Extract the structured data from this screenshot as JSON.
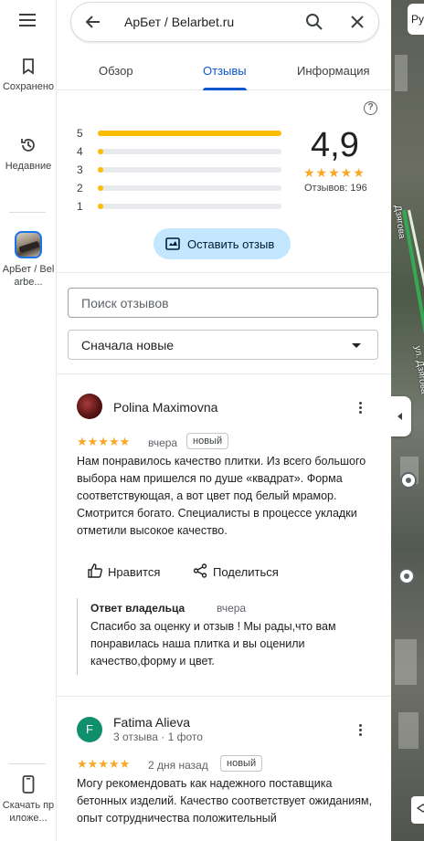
{
  "rail": {
    "saved_label": "Сохранено",
    "recent_label": "Недавние",
    "place_label": "АрБет / Belarbe...",
    "download_label": "Скачать приложе..."
  },
  "search": {
    "title": "АрБет / Belarbet.ru"
  },
  "tabs": [
    {
      "label": "Обзор",
      "active": false
    },
    {
      "label": "Отзывы",
      "active": true
    },
    {
      "label": "Информация",
      "active": false
    }
  ],
  "rating": {
    "average": "4,9",
    "total_label": "Отзывов: 196",
    "stars_filled": 5,
    "histogram": [
      {
        "stars": "5",
        "fraction": 1.0
      },
      {
        "stars": "4",
        "fraction": 0.02
      },
      {
        "stars": "3",
        "fraction": 0.01
      },
      {
        "stars": "2",
        "fraction": 0.01
      },
      {
        "stars": "1",
        "fraction": 0.02
      }
    ]
  },
  "write_review_label": "Оставить отзыв",
  "review_search_placeholder": "Поиск отзывов",
  "sort_selected": "Сначала новые",
  "reviews": [
    {
      "author": "Polina Maximovna",
      "meta": "",
      "stars": 5,
      "when": "вчера",
      "badge": "новый",
      "text": "Нам понравилось качество плитки. Из всего большого выбора нам пришелся по душе «квадрат». Форма соответствующая, а вот цвет под белый мрамор. Смотрится богато. Специалисты в процессе укладки отметили высокое качество.",
      "like_label": "Нравится",
      "share_label": "Поделиться",
      "owner_reply": {
        "heading": "Ответ владельца",
        "when": "вчера",
        "text": "Спасибо за оценку и отзыв ! Мы рады,что вам понравилась наша плитка и вы оценили качество,форму и цвет."
      }
    },
    {
      "author": "Fatima Alieva",
      "initial": "F",
      "meta": "3 отзыва · 1 фото",
      "stars": 5,
      "when": "2 дня назад",
      "badge": "новый",
      "text": "Могу рекомендовать как надежного поставщика бетонных изделий. Качество соответствует ожиданиям, опыт сотрудничества положительный"
    }
  ],
  "map": {
    "street_label_1": "Дзягова",
    "street_label_2": "ул. Дзягова",
    "chip_label": "Ру"
  },
  "colors": {
    "accent": "#0b57d0",
    "star": "#f9a825",
    "histogram_bar": "#fbbc04",
    "write_button_bg": "#c2e7ff"
  }
}
